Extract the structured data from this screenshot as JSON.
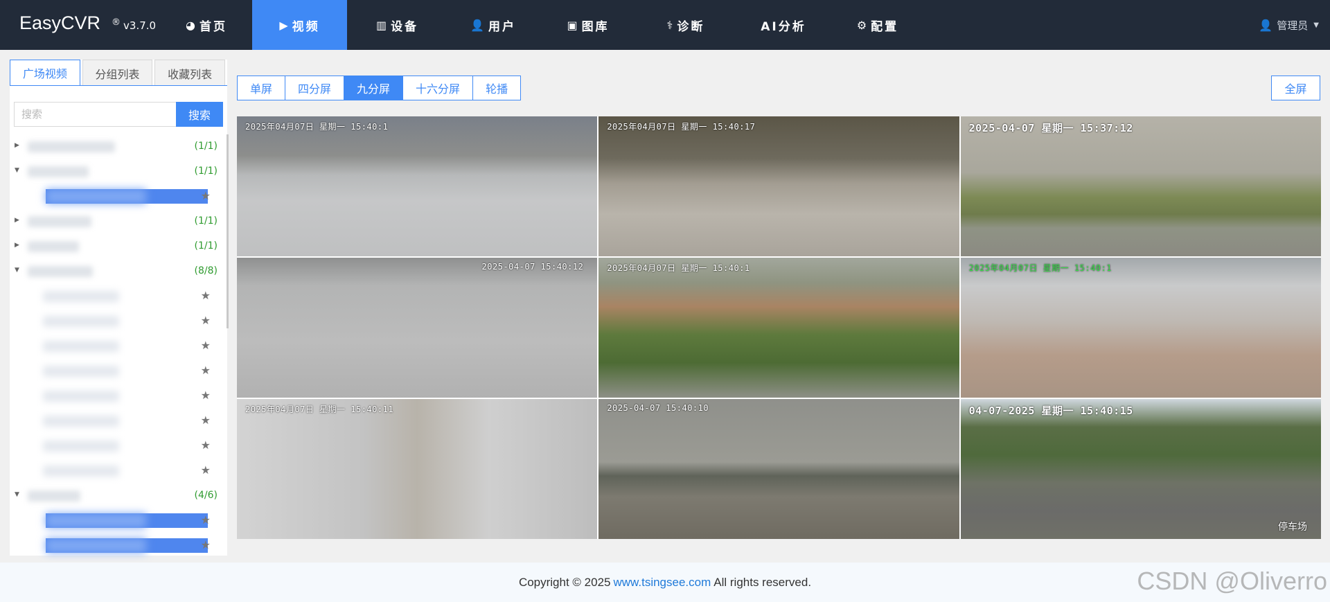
{
  "app": {
    "name": "EasyCVR",
    "reg": "®",
    "version": "v3.7.0"
  },
  "nav": [
    {
      "label": "首页",
      "icon": "dashboard-icon",
      "glyph": "◕",
      "width": 132
    },
    {
      "label": "视频",
      "icon": "play-circle-icon",
      "glyph": "▶",
      "width": 137,
      "active": true
    },
    {
      "label": "设备",
      "icon": "device-icon",
      "glyph": "▥",
      "width": 145
    },
    {
      "label": "用户",
      "icon": "user-icon",
      "glyph": "👤",
      "width": 132
    },
    {
      "label": "图库",
      "icon": "gallery-icon",
      "glyph": "▣",
      "width": 142
    },
    {
      "label": "诊断",
      "icon": "diagnose-icon",
      "glyph": "⚕",
      "width": 140
    },
    {
      "label": "AI分析",
      "icon": "",
      "glyph": "",
      "width": 142
    },
    {
      "label": "配置",
      "icon": "gear-icon",
      "glyph": "⚙",
      "width": 130
    }
  ],
  "user": {
    "label": "管理员",
    "icon": "user-icon"
  },
  "sidebar": {
    "tabs": [
      {
        "label": "广场视频",
        "active": true
      },
      {
        "label": "分组列表"
      },
      {
        "label": "收藏列表"
      }
    ],
    "search": {
      "placeholder": "搜索",
      "button": "搜索"
    },
    "tree": [
      {
        "type": "folder",
        "expanded": false,
        "count": "(1/1)",
        "w": 126
      },
      {
        "type": "folder",
        "expanded": true,
        "count": "(1/1)",
        "w": 88
      },
      {
        "type": "child",
        "online": true
      },
      {
        "type": "folder",
        "expanded": false,
        "count": "(1/1)",
        "w": 92
      },
      {
        "type": "folder",
        "expanded": false,
        "count": "(1/1)",
        "w": 74
      },
      {
        "type": "folder",
        "expanded": true,
        "count": "(8/8)",
        "w": 94
      },
      {
        "type": "child"
      },
      {
        "type": "child"
      },
      {
        "type": "child"
      },
      {
        "type": "child"
      },
      {
        "type": "child"
      },
      {
        "type": "child"
      },
      {
        "type": "child"
      },
      {
        "type": "child"
      },
      {
        "type": "folder",
        "expanded": true,
        "count": "(4/6)",
        "w": 76
      },
      {
        "type": "child",
        "online": true
      },
      {
        "type": "child",
        "online": true
      }
    ]
  },
  "toolbar": {
    "splits": [
      {
        "label": "单屏"
      },
      {
        "label": "四分屏"
      },
      {
        "label": "九分屏",
        "active": true
      },
      {
        "label": "十六分屏"
      },
      {
        "label": "轮播"
      }
    ],
    "fullscreen": "全屏"
  },
  "videos": [
    {
      "ts": "2025年04月07日 星期一 15:40:1",
      "tsStyle": "",
      "bg": "linear-gradient(180deg,#7a8089 0%,#8d8e8c 28%,#b7b9ba 42%,#c6c7c8 60%,#bfc0c1 100%)",
      "caption": ""
    },
    {
      "ts": "2025年04月07日 星期一 15:40:17",
      "tsStyle": "",
      "bg": "linear-gradient(180deg,#5b5647 0%,#6e6a5d 30%,#a39d92 48%,#b9b4ab 70%,#a9a49b 100%)",
      "caption": ""
    },
    {
      "ts": "2025-04-07 星期一 15:37:12",
      "tsStyle": "big",
      "bg": "linear-gradient(180deg,#b5b2a8 0%,#a9a79c 40%,#7d8a55 58%,#6f7c4c 70%,#8f9385 80%,#8b8a82 100%)",
      "caption": ""
    },
    {
      "ts": "2025-04-07 15:40:12",
      "tsStyle": "right",
      "bg": "linear-gradient(180deg,#8f9090 0%,#b3b4b4 20%,#bcbcbc 60%,#b1b1b1 100%)",
      "caption": ""
    },
    {
      "ts": "2025年04月07日 星期一 15:40:1",
      "tsStyle": "",
      "bg": "linear-gradient(180deg,#a2a79c 0%,#8f9481 18%,#a98463 35%,#5e7a3d 55%,#4d6b34 75%,#8d8f86 100%)",
      "caption": ""
    },
    {
      "ts": "2025年04月07日 星期一 15:40:1",
      "tsStyle": "green",
      "bg": "linear-gradient(180deg,#a3a8ab 0%,#c9cacb 20%,#bfb9b3 45%,#b59c8a 70%,#a89484 100%)",
      "caption": ""
    },
    {
      "ts": "2025年04月07日 星期一 15:40:11",
      "tsStyle": "",
      "bg": "linear-gradient(90deg,#d3d3d3 0%,#c3c3c3 35%,#b8b3aa 50%,#cfcfcf 70%,#bdbdbd 100%)",
      "caption": ""
    },
    {
      "ts": "2025-04-07 15:40:10",
      "tsStyle": "",
      "bg": "linear-gradient(180deg,#8f908b 0%,#9b9b94 45%,#5f6359 55%,#7d7a70 70%,#6f6b61 100%)",
      "caption": ""
    },
    {
      "ts": "04-07-2025 星期一 15:40:15",
      "tsStyle": "big",
      "bg": "linear-gradient(180deg,#cfd7de 0%,#5a6e46 20%,#4f6a3c 40%,#6e7266 60%,#6b6b69 80%,#6f7067 100%)",
      "caption": "停车场"
    }
  ],
  "footer": {
    "prefix": "Copyright © 2025",
    "link": "www.tsingsee.com",
    "suffix": "All rights reserved."
  },
  "watermark": "CSDN @Oliverro"
}
